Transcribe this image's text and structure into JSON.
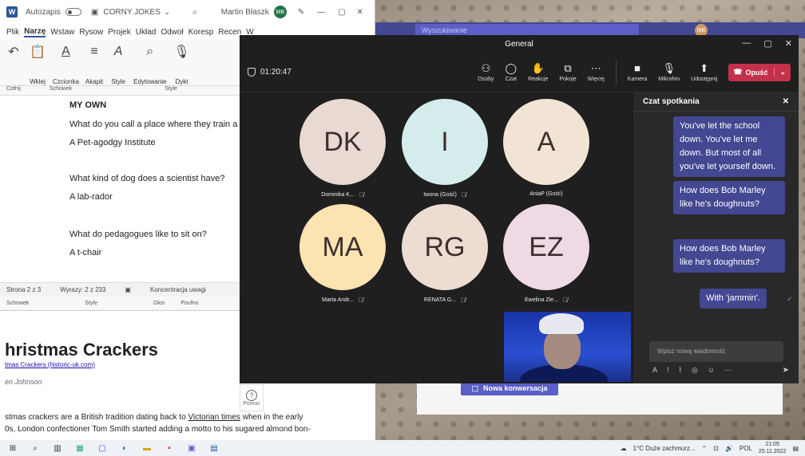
{
  "word": {
    "autosave": "Autozapis",
    "doc_title": "CORNY JOKES",
    "user": "Martin Błaszk",
    "user_initials": "MB",
    "menu": [
      "Plik",
      "Narzę",
      "Wstaw",
      "Rysow",
      "Projek",
      "Układ",
      "Odwoł",
      "Koresp",
      "Recen",
      "W"
    ],
    "ribbon": {
      "undo": "Cofnij",
      "paste": "Wklej",
      "clipboard": "Schowek",
      "font": "Czcionka",
      "paragraph": "Akapit",
      "style": "Style",
      "editing": "Edytowanie",
      "dictate": "Dykt"
    },
    "doc_lines": [
      {
        "text": "MY OWN",
        "bold": true
      },
      {
        "text": "What do you call a place where they train a",
        "bold": false
      },
      {
        "text": "A Pet-agodgy Institute",
        "bold": false
      },
      {
        "text": "What kind of dog does a scientist have?",
        "bold": false
      },
      {
        "text": "A lab-rador",
        "bold": false
      },
      {
        "text": "What do pedagogues like to sit on?",
        "bold": false
      },
      {
        "text": "A t-chair",
        "bold": false
      }
    ],
    "status": {
      "page": "Strona 2 z 3",
      "words": "Wyrazy: 2 z 233",
      "focus": "Koncentracja uwagi"
    },
    "status2": {
      "clipboard": "Schowek",
      "style": "Style",
      "voice": "Głos",
      "sensitivity": "Poufno"
    }
  },
  "web": {
    "heading": "hristmas Crackers",
    "link": "tmas Crackers (historic-uk.com)",
    "author": "en Johnson",
    "para_line1_a": "stmas crackers are a British tradition dating back to ",
    "para_line1_link": "Victorian times",
    "para_line1_b": " when in the early",
    "para_line2": "0s, London confectioner Tom Smith started adding a motto to his sugared almond bon-"
  },
  "teams_bg": {
    "search": "Wyszukiwanie",
    "user_initials": "MB",
    "new_conversation": "Nowa konwersacja",
    "help": "Pomoc"
  },
  "meeting": {
    "title": "General",
    "timer": "01:20:47",
    "tools": [
      "Osoby",
      "Czat",
      "Reakcje",
      "Pokoje",
      "Więcej"
    ],
    "tools2": [
      "Kamera",
      "Mikrofon",
      "Udostępnij"
    ],
    "leave": "Opuść",
    "participants": [
      {
        "initials": "DK",
        "name": "Dominika K...",
        "color": "#e8d9d2"
      },
      {
        "initials": "I",
        "name": "Iwona (Gość)",
        "color": "#d5ecec"
      },
      {
        "initials": "A",
        "name": "AniaP (Gość)",
        "color": "#f2e4d4"
      },
      {
        "initials": "MA",
        "name": "Marta Andr...",
        "color": "#fbe3b2"
      },
      {
        "initials": "RG",
        "name": "RENATA G...",
        "color": "#eddcd2"
      },
      {
        "initials": "EZ",
        "name": "Ewelina Zie...",
        "color": "#eed9e4"
      }
    ],
    "chat": {
      "title": "Czat spotkania",
      "messages": [
        "You've let the school down. You've let me down. But most of all you've let yourself down.",
        "How does Bob Marley like he's doughnuts?",
        "How does Bob Marley like he's doughnuts?",
        "With 'jammin'."
      ],
      "placeholder": "Wpisz nową wiadomość"
    }
  },
  "taskbar": {
    "weather": "1°C  Duże zachmurz...",
    "lang": "POL",
    "time": "21:05",
    "date": "25.11.2022"
  }
}
